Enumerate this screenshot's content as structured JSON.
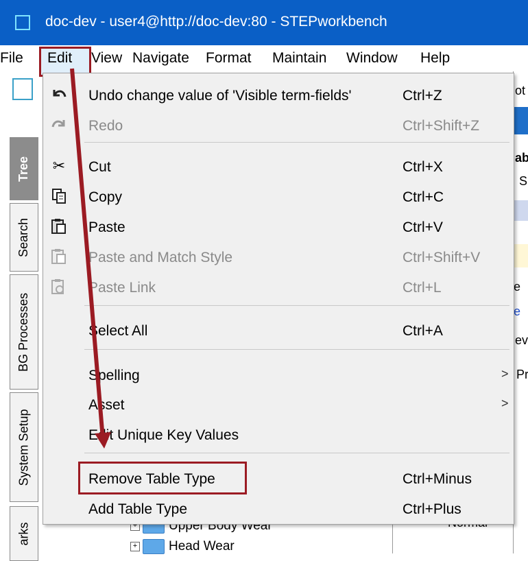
{
  "window": {
    "title": "doc-dev - user4@http://doc-dev:80 - STEPworkbench"
  },
  "menubar": [
    "File",
    "Edit",
    "View",
    "Navigate",
    "Format",
    "Maintain",
    "Window",
    "Help"
  ],
  "side_tabs": [
    "Tree",
    "Search",
    "BG Processes",
    "System Setup",
    "arks"
  ],
  "right_panel_fragments": [
    "ot",
    "ab",
    "S",
    "e",
    "e",
    "ev",
    "Pr"
  ],
  "tree": [
    {
      "label": "Upper Body Wear"
    },
    {
      "label": "Head Wear"
    }
  ],
  "background_cell": "Normal",
  "edit_menu": {
    "items": [
      {
        "label": "Undo change value of 'Visible term-fields'",
        "shortcut": "Ctrl+Z",
        "icon": "undo-icon",
        "disabled": false
      },
      {
        "label": "Redo",
        "shortcut": "Ctrl+Shift+Z",
        "icon": "redo-icon",
        "disabled": true
      },
      {
        "label": "Cut",
        "shortcut": "Ctrl+X",
        "icon": "scissors-icon",
        "disabled": false
      },
      {
        "label": "Copy",
        "shortcut": "Ctrl+C",
        "icon": "copy-icon",
        "disabled": false
      },
      {
        "label": "Paste",
        "shortcut": "Ctrl+V",
        "icon": "paste-icon",
        "disabled": false
      },
      {
        "label": "Paste and Match Style",
        "shortcut": "Ctrl+Shift+V",
        "icon": "paste-style-icon",
        "disabled": true
      },
      {
        "label": "Paste Link",
        "shortcut": "Ctrl+L",
        "icon": "paste-link-icon",
        "disabled": true
      },
      {
        "label": "Select All",
        "shortcut": "Ctrl+A",
        "icon": "",
        "disabled": false
      },
      {
        "label": "Spelling",
        "shortcut": "",
        "submenu": true,
        "icon": "",
        "disabled": false
      },
      {
        "label": "Asset",
        "shortcut": "",
        "submenu": true,
        "icon": "",
        "disabled": false
      },
      {
        "label": "Edit Unique Key Values",
        "shortcut": "",
        "icon": "",
        "disabled": false
      },
      {
        "label": "Remove Table Type",
        "shortcut": "Ctrl+Minus",
        "icon": "",
        "disabled": false
      },
      {
        "label": "Add Table Type",
        "shortcut": "Ctrl+Plus",
        "icon": "",
        "disabled": false
      }
    ],
    "submenu_arrow": ">"
  },
  "colors": {
    "titlebar": "#0a5fc6",
    "annotation": "#9b1b23",
    "menu_bg": "#f0f0f0",
    "disabled_text": "#8a8a8a"
  }
}
